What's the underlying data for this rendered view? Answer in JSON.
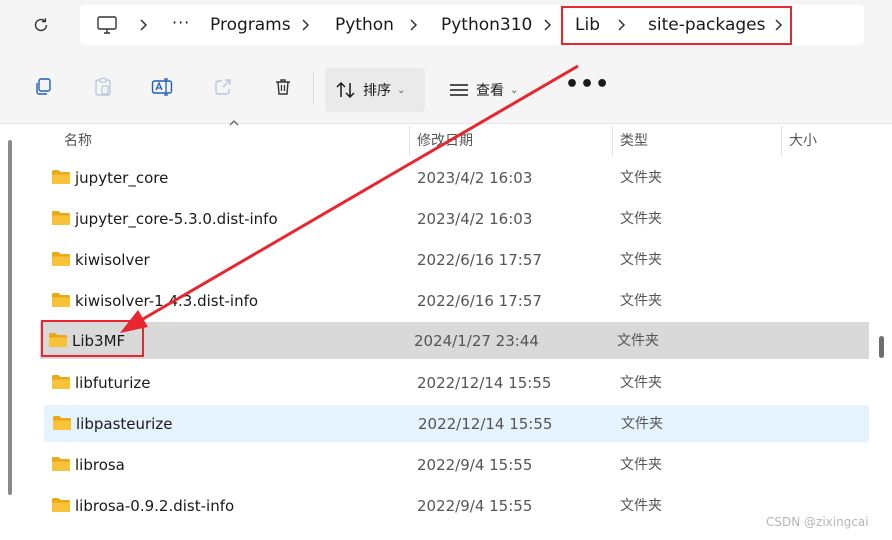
{
  "address_bar": {
    "more": "···",
    "crumbs": [
      "Programs",
      "Python",
      "Python310",
      "Lib",
      "site-packages"
    ]
  },
  "toolbar": {
    "sort_label": "排序",
    "view_label": "查看",
    "overflow": "•••"
  },
  "columns": {
    "name": "名称",
    "modified": "修改日期",
    "type": "类型",
    "size": "大小"
  },
  "rows": [
    {
      "name": "jupyter_core",
      "modified": "2023/4/2 16:03",
      "type": "文件夹"
    },
    {
      "name": "jupyter_core-5.3.0.dist-info",
      "modified": "2023/4/2 16:03",
      "type": "文件夹"
    },
    {
      "name": "kiwisolver",
      "modified": "2022/6/16 17:57",
      "type": "文件夹"
    },
    {
      "name": "kiwisolver-1.4.3.dist-info",
      "modified": "2022/6/16 17:57",
      "type": "文件夹"
    },
    {
      "name": "Lib3MF",
      "modified": "2024/1/27 23:44",
      "type": "文件夹"
    },
    {
      "name": "libfuturize",
      "modified": "2022/12/14 15:55",
      "type": "文件夹"
    },
    {
      "name": "libpasteurize",
      "modified": "2022/12/14 15:55",
      "type": "文件夹"
    },
    {
      "name": "librosa",
      "modified": "2022/9/4 15:55",
      "type": "文件夹"
    },
    {
      "name": "librosa-0.9.2.dist-info",
      "modified": "2022/9/4 15:55",
      "type": "文件夹"
    }
  ],
  "icons": {
    "refresh": "refresh-icon",
    "this_pc": "computer-icon",
    "copy": "copy-icon",
    "paste": "paste-icon",
    "rename": "rename-icon",
    "share": "share-icon",
    "delete": "trash-icon",
    "sort": "sort-icon",
    "view": "view-icon",
    "folder": "folder-icon"
  },
  "colors": {
    "selection": "#d9d9d9",
    "hover": "#e5f3ff",
    "folder": "#f8c33a",
    "annotation": "#e8262f"
  },
  "watermark": "CSDN @zixingcai"
}
